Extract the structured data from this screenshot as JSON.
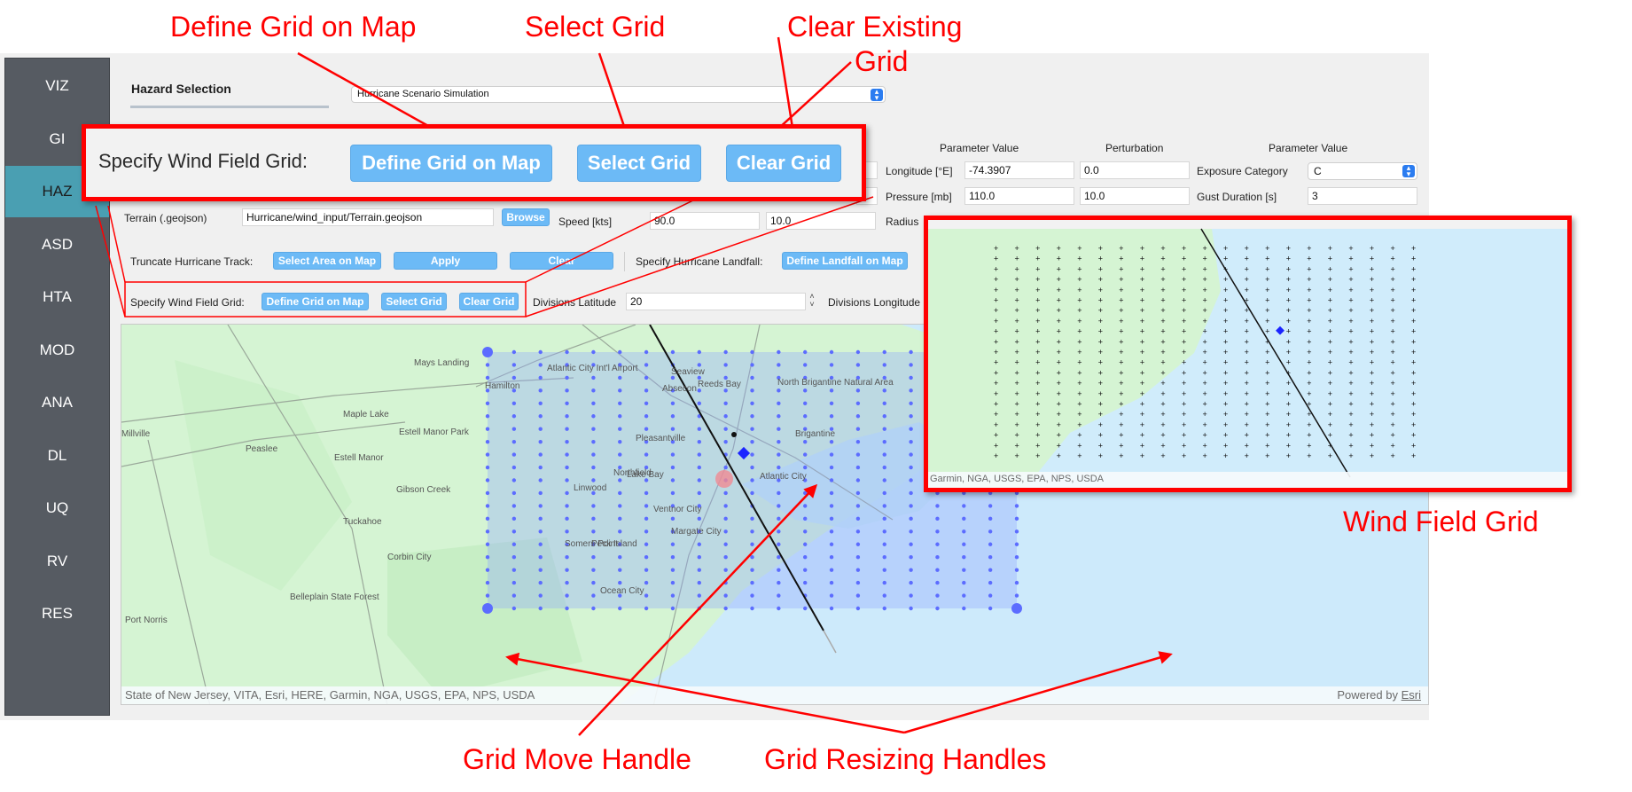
{
  "sidebar": {
    "items": [
      {
        "label": "VIZ",
        "active": false
      },
      {
        "label": "GI",
        "active": false
      },
      {
        "label": "HAZ",
        "active": true
      },
      {
        "label": "ASD",
        "active": false
      },
      {
        "label": "HTA",
        "active": false
      },
      {
        "label": "MOD",
        "active": false
      },
      {
        "label": "ANA",
        "active": false
      },
      {
        "label": "DL",
        "active": false
      },
      {
        "label": "UQ",
        "active": false
      },
      {
        "label": "RV",
        "active": false
      },
      {
        "label": "RES",
        "active": false
      }
    ]
  },
  "hazard": {
    "section_title": "Hazard Selection",
    "type_selected": "Hurricane Scenario Simulation"
  },
  "params": {
    "col_headers": {
      "param_value_1": "Parameter Value",
      "perturbation": "Perturbation",
      "param_value_2": "Parameter Value"
    },
    "longitude": {
      "label": "Longitude [°E]",
      "value": "-74.3907",
      "perturbation": "0.0"
    },
    "pressure": {
      "label": "Pressure [mb]",
      "value": "110.0",
      "perturbation": "10.0"
    },
    "speed": {
      "label": "Speed [kts]",
      "value": "90.0",
      "perturbation": "10.0"
    },
    "radius": {
      "label": "Radius"
    },
    "exposure": {
      "label": "Exposure Category",
      "value": "C"
    },
    "gust": {
      "label": "Gust Duration [s]",
      "value": "3"
    }
  },
  "terrain": {
    "label": "Terrain (.geojson)",
    "value": "Hurricane/wind_input/Terrain.geojson",
    "browse_label": "Browse"
  },
  "truncate": {
    "label": "Truncate Hurricane Track:",
    "select_area": "Select Area on Map",
    "apply": "Apply",
    "clear": "Clear"
  },
  "landfall": {
    "label": "Specify Hurricane Landfall:",
    "button": "Define Landfall on Map"
  },
  "wind_grid": {
    "label": "Specify Wind Field Grid:",
    "define": "Define Grid on Map",
    "select": "Select Grid",
    "clear": "Clear Grid",
    "div_lat_label": "Divisions Latitude",
    "div_lat_value": "20",
    "div_lon_label": "Divisions Longitude"
  },
  "map": {
    "labels": [
      "Mays Landing",
      "Hamilton",
      "Atlantic City Int'l Airport",
      "Absecon",
      "Seaview",
      "Reeds Bay",
      "North Brigantine Natural Area",
      "Brigantine",
      "Pleasantville",
      "Northfield",
      "Linwood",
      "Lake Bay",
      "Atlantic City",
      "Ventnor City",
      "Margate City",
      "Somers Point",
      "Peck Island",
      "Ocean City",
      "Estell Manor",
      "Estell Manor Park",
      "Maple Lake",
      "Peaslee",
      "Millville",
      "Gibson Creek",
      "Tuckahoe",
      "Corbin City",
      "Belleplain State Forest",
      "Port Norris"
    ],
    "attribution": "State of New Jersey, VITA, Esri, HERE, Garmin, NGA, USGS, EPA, NPS, USDA",
    "powered_by": "Powered by",
    "esri": "Esri",
    "grid_points_per_axis": 21,
    "accent": "#5c6cff"
  },
  "inset": {
    "attribution": "Garmin, NGA, USGS, EPA, NPS, USDA"
  },
  "annotations": {
    "define_grid": "Define Grid on Map",
    "select_grid": "Select Grid",
    "clear_existing_1": "Clear  Existing",
    "clear_existing_2": "Grid",
    "callout_label": "Specify Wind Field Grid:",
    "callout_define": "Define Grid on Map",
    "callout_select": "Select Grid",
    "callout_clear": "Clear Grid",
    "wind_field_grid": "Wind Field Grid",
    "grid_move_handle": "Grid Move Handle",
    "grid_resizing_handles": "Grid Resizing Handles",
    "color": "#ff0000"
  }
}
